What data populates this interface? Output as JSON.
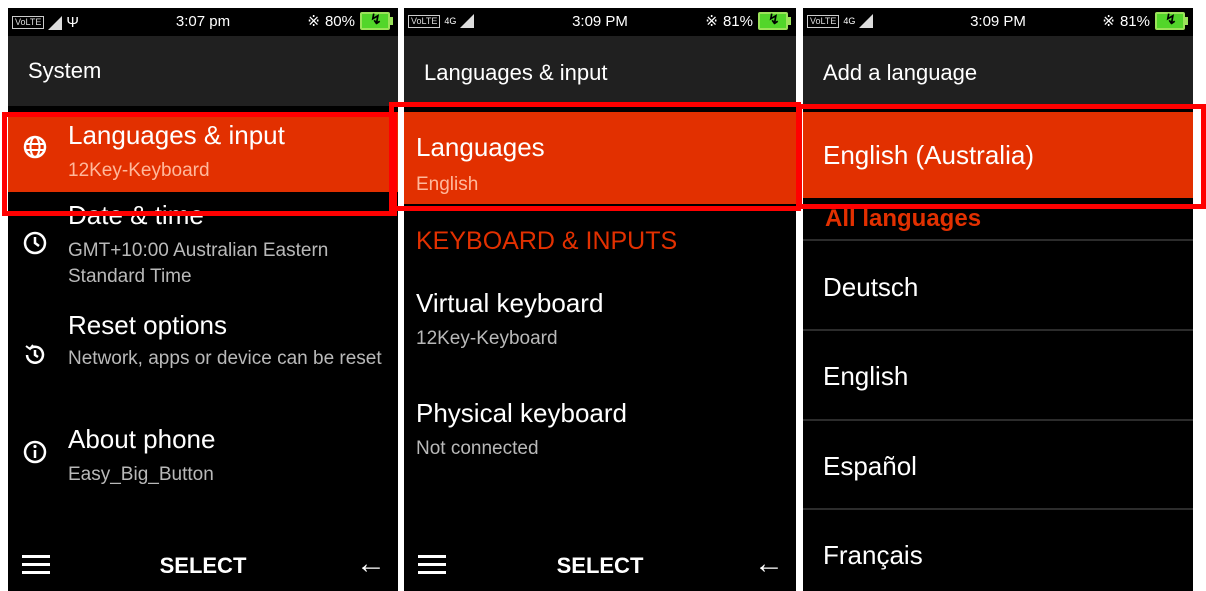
{
  "panels": [
    {
      "status": {
        "network": "VoLTE",
        "left_extra": "Ψ",
        "time": "3:07 pm",
        "battery": "80%"
      },
      "title": "System",
      "items": [
        {
          "title": "Languages & input",
          "subtitle": "12Key-Keyboard",
          "icon": "globe-icon"
        },
        {
          "title": "Date & time",
          "subtitle": "GMT+10:00 Australian Eastern Standard Time",
          "icon": "clock-icon"
        },
        {
          "title": "Reset options",
          "subtitle": "Network, apps or device can be reset",
          "icon": "history-icon"
        },
        {
          "title": "About phone",
          "subtitle": "Easy_Big_Button",
          "icon": "info-icon"
        }
      ],
      "softkey": "SELECT"
    },
    {
      "status": {
        "network": "VoLTE",
        "signal": "4G",
        "time": "3:09 PM",
        "battery": "81%"
      },
      "title": "Languages & input",
      "items": [
        {
          "title": "Languages",
          "subtitle": "English"
        },
        {
          "title": "Virtual keyboard",
          "subtitle": "12Key-Keyboard"
        },
        {
          "title": "Physical keyboard",
          "subtitle": "Not connected"
        }
      ],
      "category": "KEYBOARD & INPUTS",
      "softkey": "SELECT"
    },
    {
      "status": {
        "network": "VoLTE",
        "signal": "4G",
        "time": "3:09 PM",
        "battery": "81%"
      },
      "title": "Add a language",
      "selected": "English (Australia)",
      "category": "All languages",
      "languages": [
        "Deutsch",
        "English",
        "Español",
        "Français"
      ]
    }
  ],
  "colors": {
    "accent": "#e23000",
    "highlight_box": "#ff0000",
    "background": "#000000",
    "titlebar": "#202020"
  }
}
